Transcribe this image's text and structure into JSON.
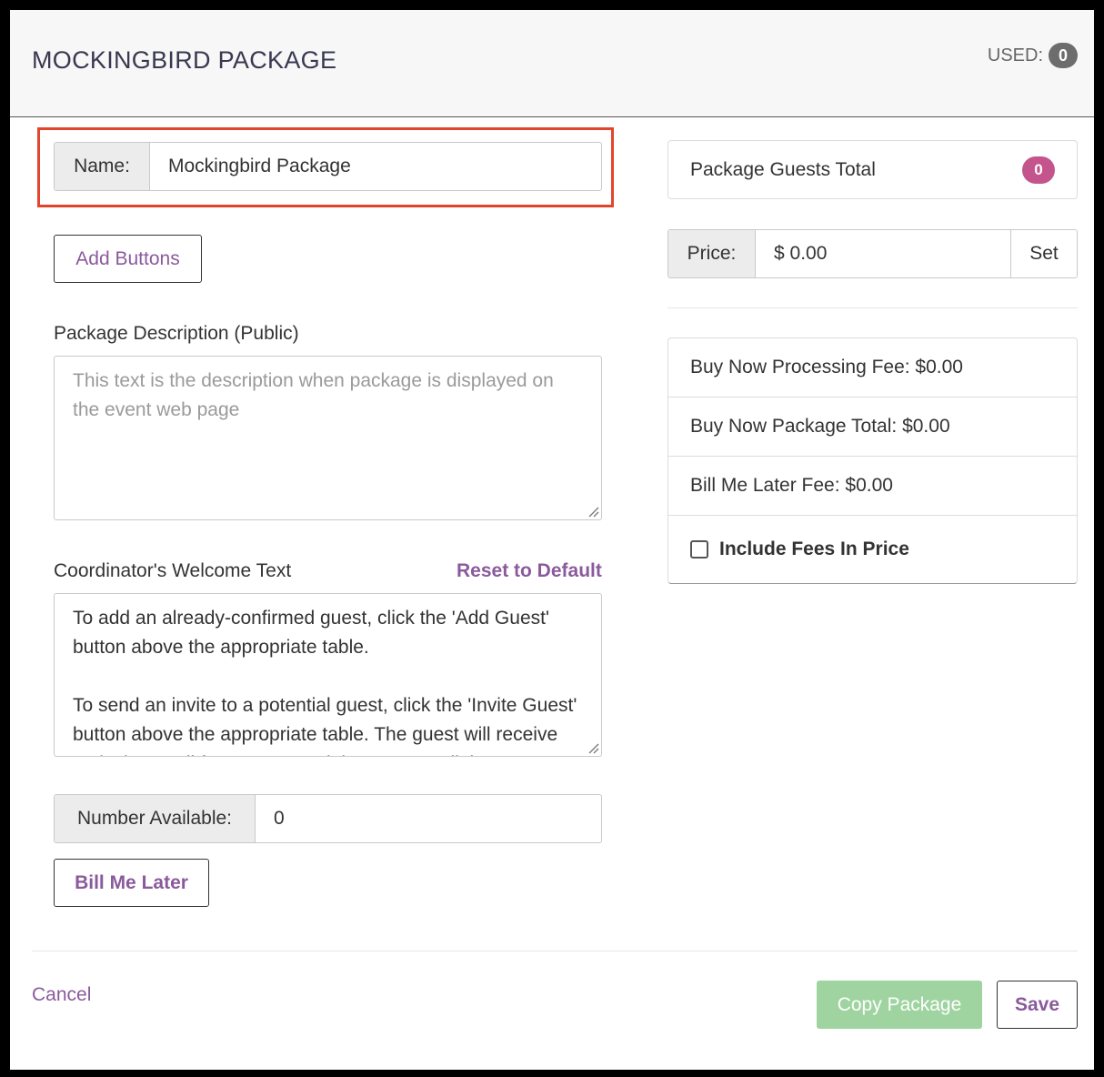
{
  "header": {
    "title": "MOCKINGBIRD PACKAGE",
    "used_label": "USED:",
    "used_count": "0"
  },
  "name_field": {
    "label": "Name:",
    "value": "Mockingbird Package"
  },
  "add_buttons_label": "Add Buttons",
  "description": {
    "label": "Package Description (Public)",
    "placeholder": "This text is the description when package is displayed on the event web page"
  },
  "welcome": {
    "label": "Coordinator's Welcome Text",
    "reset_label": "Reset to Default",
    "text": "To add an already-confirmed guest, click the 'Add Guest' button above the appropriate table.\n\nTo send an invite to a potential guest, click the 'Invite Guest' button above the appropriate table. The guest will receive an invite email from you containing a secure link to your event."
  },
  "number_available": {
    "label": "Number Available:",
    "value": "0"
  },
  "bill_me_later_label": "Bill Me Later",
  "guests_total": {
    "label": "Package Guests Total",
    "count": "0"
  },
  "price": {
    "label": "Price:",
    "value": "$ 0.00",
    "set_label": "Set"
  },
  "fees": {
    "processing_fee": "Buy Now Processing Fee: $0.00",
    "package_total": "Buy Now Package Total: $0.00",
    "bill_later_fee": "Bill Me Later Fee: $0.00",
    "include_fees_label": "Include Fees In Price"
  },
  "footer": {
    "cancel_label": "Cancel",
    "copy_label": "Copy Package",
    "save_label": "Save"
  },
  "colors": {
    "accent_purple": "#8a5a9c",
    "badge_pink": "#c4548c",
    "copy_green": "#9fd4a0",
    "highlight_red": "#e2452b"
  }
}
